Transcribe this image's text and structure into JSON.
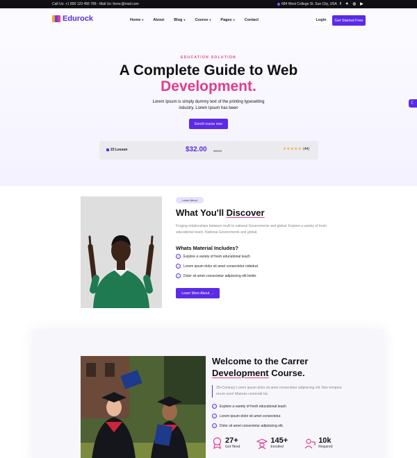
{
  "topbar": {
    "contact": "Call Us: +1 800 123 456 789 - Mail Us: ltoroc@mail.com",
    "address": "684 West College St. Sun City, USA",
    "socials": [
      "facebook-icon",
      "twitter-icon",
      "instagram-icon",
      "youtube-icon"
    ]
  },
  "header": {
    "logo": "Edurock",
    "nav": [
      {
        "label": "Home",
        "dropdown": true
      },
      {
        "label": "About",
        "dropdown": false
      },
      {
        "label": "Blog",
        "dropdown": true
      },
      {
        "label": "Course",
        "dropdown": true
      },
      {
        "label": "Pages",
        "dropdown": true
      },
      {
        "label": "Contact",
        "dropdown": false
      }
    ],
    "login": "Login",
    "cta": "Get Started Free"
  },
  "hero": {
    "eyebrow": "EDUCATION SOLUTION",
    "title_line1": "A Complete Guide to Web",
    "title_line2": "Development.",
    "subtitle": "Lorem Ipsum is simply dummy text of the printing typesetting industry. Lorem Ipsum has been",
    "button": "Enroll course now",
    "stats": {
      "lessons": "23 Lesson",
      "price": "$32.00",
      "old_price": "$68.00",
      "rating_stars": "★★★★★",
      "reviews": "(44)"
    }
  },
  "discover": {
    "badge": "Learn About",
    "title_plain": "What You'll ",
    "title_accent": "Discover",
    "paragraph": "Forging relationships between multi to national Governments and global. Explore a variety of fresh educational teach. National Governments and global.",
    "subheading": "Whats Material Includes?",
    "items": [
      "Explore a variety of fresh educational teach",
      "Lorem ipsum dolor sit amet consectetur nidedud.",
      "Dolor sit amet consectetur adipisicing elit bnide."
    ],
    "button": "Learn More About →"
  },
  "career": {
    "title_line1": "Welcome to the Carrer",
    "title_accent": "Development",
    "title_end": " Course.",
    "paragraph": "25+Contrary Lorem ipsum dolor sit amet consectetur adipisicing elit. Non tempore rerum vero! Maiores commodi hic.",
    "items": [
      "Explore a variety of fresh educational teach",
      "Lorem ipsum dolor sit amet consectetur.",
      "Dolor sit amet consectetur adipisicing elit."
    ],
    "metrics": [
      {
        "value": "27+",
        "label": "Got Hired",
        "icon": "hired-icon"
      },
      {
        "value": "145+",
        "label": "Enrolled",
        "icon": "enrolled-icon"
      },
      {
        "value": "10k",
        "label": "Required",
        "icon": "required-icon"
      }
    ]
  },
  "colors": {
    "primary": "#5b2be6",
    "accent": "#e03d8e",
    "dark": "#0f0f14"
  }
}
